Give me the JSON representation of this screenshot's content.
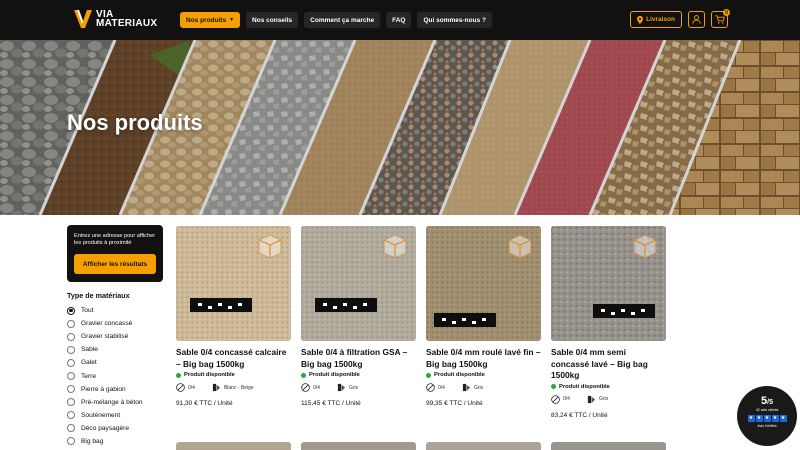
{
  "header": {
    "logo_line1": "VIA",
    "logo_line2": "MATERIAUX",
    "nav": [
      {
        "label": "Nos produits",
        "active": true
      },
      {
        "label": "Nos conseils"
      },
      {
        "label": "Comment ça marche"
      },
      {
        "label": "FAQ"
      },
      {
        "label": "Qui sommes-nous ?"
      }
    ],
    "delivery_label": "Livraison",
    "cart_count": "0"
  },
  "hero": {
    "title": "Nos produits"
  },
  "sidebar": {
    "address_prompt": "Entrez une adresse pour afficher les produits à proximité",
    "address_button": "Afficher les résultats",
    "filter_title": "Type de matériaux",
    "filters": [
      {
        "label": "Tout",
        "checked": true
      },
      {
        "label": "Gravier concassé"
      },
      {
        "label": "Gravier stabilisé"
      },
      {
        "label": "Sable"
      },
      {
        "label": "Galet"
      },
      {
        "label": "Terre"
      },
      {
        "label": "Pierre à gabion"
      },
      {
        "label": "Pré-mélange à béton"
      },
      {
        "label": "Soutènement"
      },
      {
        "label": "Déco paysagère"
      },
      {
        "label": "Big bag"
      }
    ]
  },
  "products": [
    {
      "title": "Sable 0/4 concassé calcaire – Big bag 1500kg",
      "stock": "Produit disponible",
      "grain": "0/4",
      "color": "Blanc - Beige",
      "price": "91,30 € TTC / Unité"
    },
    {
      "title": "Sable 0/4 à filtration GSA – Big bag 1500kg",
      "stock": "Produit disponible",
      "grain": "0/4",
      "color": "Gris",
      "price": "115,45 € TTC / Unité"
    },
    {
      "title": "Sable 0/4 mm roulé lavé fin – Big bag 1500kg",
      "stock": "Produit disponible",
      "grain": "0/4",
      "color": "Gris",
      "price": "99,35 € TTC / Unité"
    },
    {
      "title": "Sable 0/4 mm semi concassé lavé – Big bag 1500kg",
      "stock": "Produit disponible",
      "grain": "0/4",
      "color": "Gris",
      "price": "83,24 € TTC / Unité"
    }
  ],
  "rating": {
    "score": "5",
    "out_of": "/5",
    "reviews": "42 avis clients",
    "brand": "Avis Vérifiés"
  },
  "colors": {
    "accent": "#f5a000",
    "dark": "#111111",
    "available": "#29a745"
  }
}
